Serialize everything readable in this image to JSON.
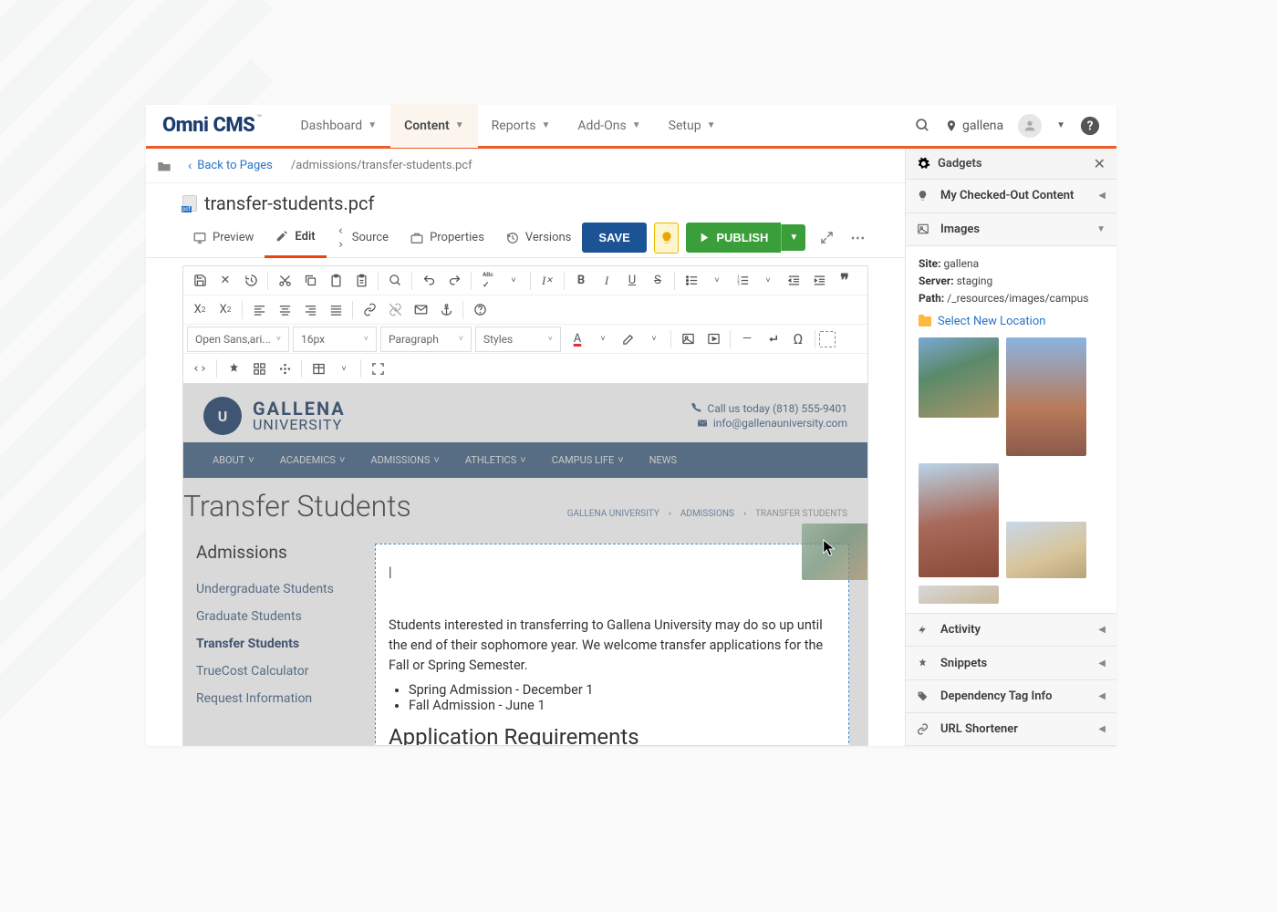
{
  "brand": "Omni CMS",
  "topnav": [
    {
      "label": "Dashboard"
    },
    {
      "label": "Content",
      "active": true
    },
    {
      "label": "Reports"
    },
    {
      "label": "Add-Ons"
    },
    {
      "label": "Setup"
    }
  ],
  "site_name": "gallena",
  "pathbar": {
    "back": "Back to Pages",
    "path": "/admissions/transfer-students.pcf"
  },
  "filename": "transfer-students.pcf",
  "file_tabs": [
    {
      "label": "Preview",
      "icon": "monitor"
    },
    {
      "label": "Edit",
      "icon": "pencil",
      "active": true
    },
    {
      "label": "Source",
      "icon": "brackets"
    },
    {
      "label": "Properties",
      "icon": "briefcase"
    },
    {
      "label": "Versions",
      "icon": "history"
    }
  ],
  "actions": {
    "save": "SAVE",
    "publish": "PUBLISH"
  },
  "font_family": "Open Sans,ari...",
  "font_size": "16px",
  "block_format": "Paragraph",
  "style_format": "Styles",
  "site": {
    "uni_letter": "U",
    "uni_line1": "GALLENA",
    "uni_line2": "UNIVERSITY",
    "phone": "Call us today (818) 555-9401",
    "email": "info@gallenauniversity.com",
    "nav": [
      "ABOUT",
      "ACADEMICS",
      "ADMISSIONS",
      "ATHLETICS",
      "CAMPUS LIFE",
      "NEWS"
    ],
    "page_title": "Transfer Students",
    "crumbs": [
      "GALLENA UNIVERSITY",
      "ADMISSIONS",
      "TRANSFER STUDENTS"
    ],
    "sidenav_title": "Admissions",
    "sidenav": [
      {
        "label": "Undergraduate Students"
      },
      {
        "label": "Graduate Students"
      },
      {
        "label": "Transfer Students",
        "current": true
      },
      {
        "label": "TrueCost Calculator"
      },
      {
        "label": "Request Information"
      }
    ],
    "body_para": "Students interested in transferring to Gallena University may do so up until the end of their sophomore year. We welcome transfer applications for the Fall or Spring Semester.",
    "list": [
      "Spring Admission - December 1",
      "Fall Admission - June 1"
    ],
    "h2": "Application Requirements"
  },
  "gadgets": {
    "title": "Gadgets",
    "checkout": "My Checked-Out Content",
    "images": {
      "title": "Images",
      "site_lbl": "Site:",
      "site": "gallena",
      "server_lbl": "Server:",
      "server": "staging",
      "path_lbl": "Path:",
      "path": "/_resources/images/campus",
      "select": "Select New Location"
    },
    "activity": "Activity",
    "snippets": "Snippets",
    "dep": "Dependency Tag Info",
    "url": "URL Shortener"
  }
}
